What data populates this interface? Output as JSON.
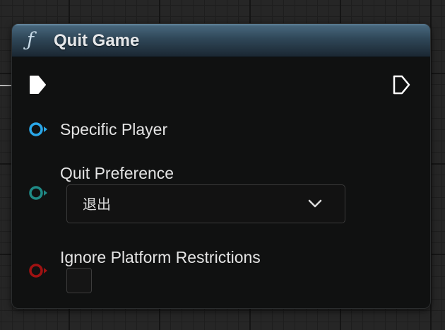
{
  "node": {
    "title": "Quit Game",
    "icon": "function-icon",
    "icon_glyph": "ƒ",
    "header_color": "#2f4758"
  },
  "pins": {
    "specific_player": {
      "label": "Specific Player",
      "color": "#2aa7e8"
    },
    "quit_preference": {
      "label": "Quit Preference",
      "color": "#1f8a86",
      "value": "退出"
    },
    "ignore_platform_restrictions": {
      "label": "Ignore Platform Restrictions",
      "color": "#a01212",
      "checked": false
    }
  }
}
